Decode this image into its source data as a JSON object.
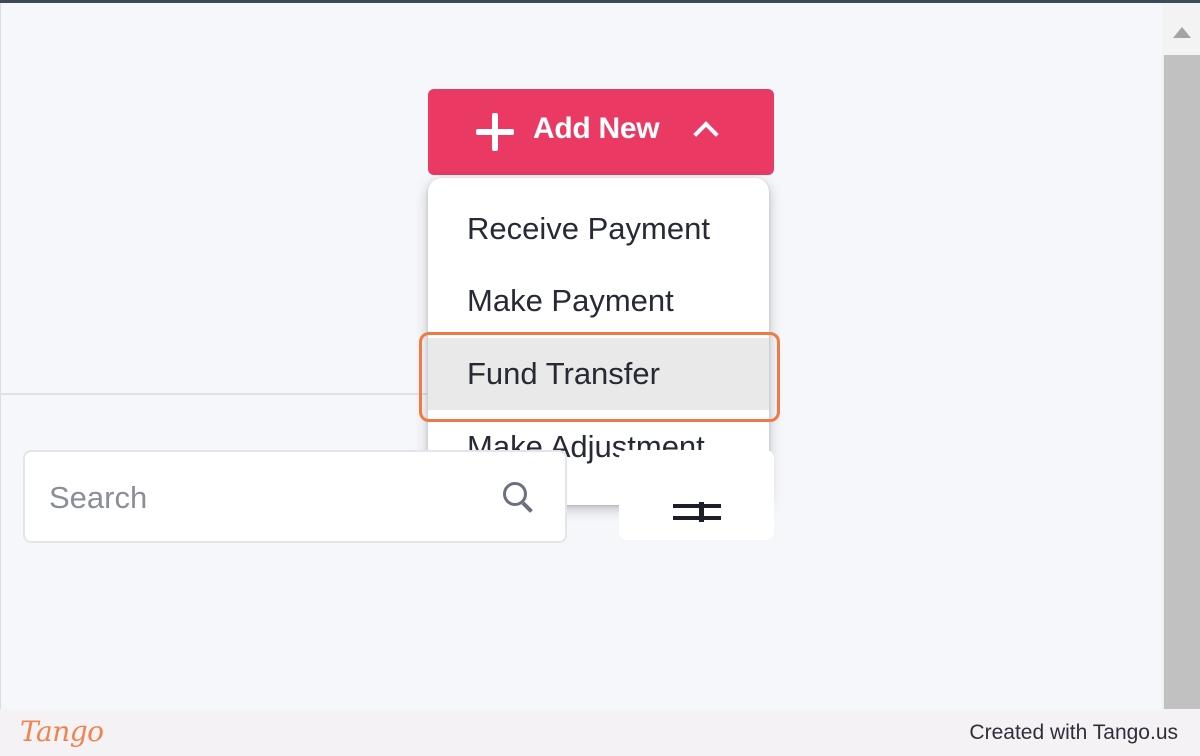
{
  "toolbar": {
    "add_new_label": "Add New"
  },
  "add_new_menu": {
    "items": [
      {
        "label": "Receive Payment",
        "highlighted": false
      },
      {
        "label": "Make Payment",
        "highlighted": false
      },
      {
        "label": "Fund Transfer",
        "highlighted": true
      },
      {
        "label": "Make Adjustment",
        "highlighted": false
      }
    ]
  },
  "search": {
    "placeholder": "Search",
    "value": ""
  },
  "icons": {
    "add": "plus-icon",
    "collapse": "chevron-up-icon",
    "search": "search-icon",
    "filter": "filter-icon",
    "scroll_up": "scroll-up-arrow-icon"
  },
  "colors": {
    "accent": "#ea3a64",
    "highlight_outline": "#f07a45",
    "page_background": "#f6f7fb",
    "menu_hover": "#e9e9ea"
  },
  "footer": {
    "logo_text": "Tango",
    "credit": "Created with Tango.us"
  }
}
